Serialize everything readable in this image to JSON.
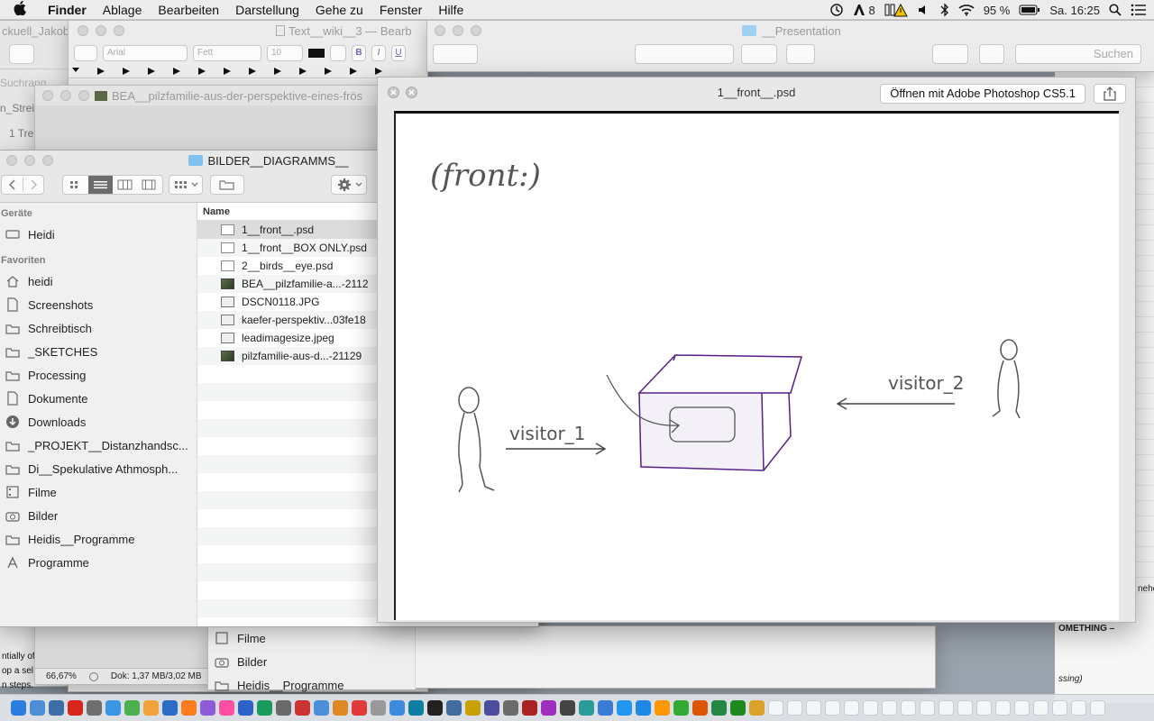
{
  "menubar": {
    "app": "Finder",
    "items": [
      "Ablage",
      "Bearbeiten",
      "Darstellung",
      "Gehe zu",
      "Fenster",
      "Hilfe"
    ],
    "status": {
      "adobe_count": "8",
      "battery": "95 %",
      "clock": "Sa. 16:25"
    }
  },
  "bg_windows": {
    "w1_title": "ckuell_Jakob_",
    "w2_title": "Text__wiki__3 — Bearb",
    "w2_font": "Arial",
    "w2_style": "Fett",
    "w2_size": "10",
    "w2_bold": "B",
    "w2_italic": "I",
    "w2_underline": "U",
    "w3_title": "__Presentation",
    "w3_search": "Suchen",
    "w4_title": "BEA__pilzfamilie-aus-der-perspektive-eines-frös",
    "left_fragments": [
      "Suchrang",
      "n_Streif",
      "1 Tref"
    ],
    "bottom_zoom": "66,67%",
    "bottom_doc": "Dok: 1,37 MB/3,02 MB",
    "bottom_left_text": [
      "ntially of",
      "op a sel",
      "n steps."
    ],
    "behind_sidebar": [
      "Filme",
      "Bilder",
      "Heidis__Programme"
    ],
    "right_text": [
      "OMETHING –",
      "ssing)",
      "nehc"
    ]
  },
  "finder": {
    "title": "BILDER__DIAGRAMMS__",
    "sidebar": {
      "devices_header": "Geräte",
      "devices": [
        {
          "label": "Heidi",
          "icon": "disk-icon"
        }
      ],
      "favorites_header": "Favoriten",
      "favorites": [
        {
          "label": "heidi",
          "icon": "home-icon"
        },
        {
          "label": "Screenshots",
          "icon": "document-icon"
        },
        {
          "label": "Schreibtisch",
          "icon": "folder-icon"
        },
        {
          "label": "_SKETCHES",
          "icon": "folder-icon"
        },
        {
          "label": "Processing",
          "icon": "folder-icon"
        },
        {
          "label": "Dokumente",
          "icon": "document-icon"
        },
        {
          "label": "Downloads",
          "icon": "download-icon"
        },
        {
          "label": "_PROJEKT__Distanzhandsc...",
          "icon": "folder-icon"
        },
        {
          "label": "Di__Spekulative Athmosph...",
          "icon": "folder-icon"
        },
        {
          "label": "Filme",
          "icon": "film-icon"
        },
        {
          "label": "Bilder",
          "icon": "camera-icon"
        },
        {
          "label": "Heidis__Programme",
          "icon": "folder-icon"
        },
        {
          "label": "Programme",
          "icon": "apps-icon"
        }
      ]
    },
    "column_name": "Name",
    "files": [
      {
        "name": "1__front__.psd",
        "kind": "psd",
        "selected": true
      },
      {
        "name": "1__front__BOX ONLY.psd",
        "kind": "psd",
        "selected": false
      },
      {
        "name": "2__birds__eye.psd",
        "kind": "psd",
        "selected": false
      },
      {
        "name": "BEA__pilzfamilie-a...-2112",
        "kind": "img",
        "selected": false
      },
      {
        "name": "DSCN0118.JPG",
        "kind": "jpg",
        "selected": false
      },
      {
        "name": "kaefer-perspektiv...03fe18",
        "kind": "jpg",
        "selected": false
      },
      {
        "name": "leadimagesize.jpeg",
        "kind": "jpg",
        "selected": false
      },
      {
        "name": "pilzfamilie-aus-d...-21129",
        "kind": "img",
        "selected": false
      }
    ]
  },
  "quicklook": {
    "title": "1__front__.psd",
    "open_button": "Öffnen mit Adobe Photoshop CS5.1",
    "sketch": {
      "heading": "(front:)",
      "label_1": "visitor_1",
      "label_2": "visitor_2"
    }
  }
}
